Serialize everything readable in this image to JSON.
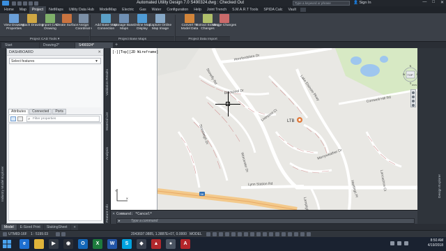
{
  "window": {
    "title": "Automated Utility Design 7.0    S490324.dwg : Checked Out",
    "search_placeholder": "Type a keyword or phrase",
    "signin_label": "Sign In",
    "controls": [
      "—",
      "□",
      "✕"
    ]
  },
  "ribbon": {
    "tabs": [
      "Home",
      "Map",
      "Project",
      "NetMaps",
      "Utility Data Hub",
      "ModelMap",
      "Electric",
      "Gas",
      "Water",
      "Configuration",
      "Help",
      "Joint Trench",
      "S.M.A.R.T Tools",
      "SPIDA Calc",
      "Vault"
    ],
    "active_tab": "Project",
    "buttons": [
      {
        "label": "View Drawing Properties",
        "icon": "properties-icon"
      },
      {
        "label": "Attach Drawing",
        "icon": "attach-icon"
      },
      {
        "label": "Import CAD Drawing",
        "icon": "import-cad-icon"
      },
      {
        "label": "Create Surface",
        "icon": "surface-icon"
      },
      {
        "label": "Assign Coordinate",
        "icon": "coordinate-icon"
      },
      {
        "label": "Add Base Map Connection",
        "icon": "add-basemap-icon"
      },
      {
        "label": "Manage Base Maps",
        "icon": "manage-basemaps-icon"
      },
      {
        "label": "Online Map Display",
        "icon": "online-map-icon"
      },
      {
        "label": "Capture Online Map Image",
        "icon": "capture-map-icon"
      },
      {
        "label": "Convert To Model Data",
        "icon": "convert-model-icon"
      },
      {
        "label": "Extract Existing Changes",
        "icon": "extract-icon"
      },
      {
        "label": "Merge Changes",
        "icon": "merge-icon"
      }
    ],
    "groups": [
      "Project CAD Tools ▾",
      "Project Base Maps",
      "Project Data Import"
    ]
  },
  "doc_tabs": {
    "items": [
      "Start",
      "Drawing2*",
      "S490324*"
    ],
    "active": "S490324*",
    "plus": "+"
  },
  "left_strip": {
    "label": "Industry Model Explorer"
  },
  "dashboard": {
    "title": "DASHBOARD",
    "close": "✕",
    "select_value": "Select features",
    "tabs": [
      "Attributes",
      "Connected",
      "Ports"
    ],
    "active_tab": "Attributes",
    "filter_placeholder": "Filter properties"
  },
  "mid_strip": {
    "labels": [
      "Feature Info",
      "Analysis",
      "Material List",
      "Validation Results"
    ]
  },
  "viewport": {
    "label": "[-][Top][2D Wireframe]",
    "map_labels": [
      "Herefordshire Dr",
      "Blackpool Dr",
      "Lake Elsinore Pkwy",
      "Liverpool Ct",
      "Cornwell Hill Rd",
      "Lynn Station Rd",
      "Hastings Pl",
      "Lancashire Ct",
      "Stoneleigh Dr",
      "Worcester Dr",
      "Stonefly Rd",
      "Merryweather Dr",
      "Lamplighter Dr"
    ],
    "poi_label": "LTB",
    "route_shield": "58",
    "ucs_x": "X",
    "ucs_y": "Y"
  },
  "viewcube": {
    "face": "TOP",
    "n": "N",
    "s": "S",
    "e": "E",
    "w": "W",
    "wcs": "WCS"
  },
  "right_strip": {
    "label": "Design Explorer"
  },
  "command": {
    "history": "Command: *Cancel*",
    "placeholder": "Type a command"
  },
  "layout_tabs": {
    "items": [
      "Model",
      "E-Sized Print",
      "StakingSheet"
    ],
    "active": "Model",
    "plus": "+"
  },
  "status": {
    "crs": "UTM83-16F",
    "scale": "1 : 5199.03",
    "coords": "2043697.0885, 1.3887E+07, 0.0000",
    "mode": "MODEL"
  },
  "taskbar": {
    "apps": [
      {
        "name": "ie-icon",
        "glyph": "e",
        "color": "#1e6fd0"
      },
      {
        "name": "folder-icon",
        "glyph": "",
        "color": "#e0b43a"
      },
      {
        "name": "media-icon",
        "glyph": "▶",
        "color": "#333a44"
      },
      {
        "name": "chrome-icon",
        "glyph": "◉",
        "color": "#2a2f38"
      },
      {
        "name": "outlook-icon",
        "glyph": "O",
        "color": "#1467b8"
      },
      {
        "name": "excel-icon",
        "glyph": "X",
        "color": "#1d7a3d"
      },
      {
        "name": "word-icon",
        "glyph": "W",
        "color": "#2356a8"
      },
      {
        "name": "skype-icon",
        "glyph": "S",
        "color": "#00a3e0"
      },
      {
        "name": "app-icon-1",
        "glyph": "◆",
        "color": "#3a4250"
      },
      {
        "name": "app-icon-2",
        "glyph": "▲",
        "color": "#b1292d"
      },
      {
        "name": "app-icon-3",
        "glyph": "●",
        "color": "#4b5563"
      },
      {
        "name": "autocad-icon",
        "glyph": "A",
        "color": "#b4262a"
      }
    ],
    "time": "8:50 AM",
    "date": "4/19/2018"
  }
}
